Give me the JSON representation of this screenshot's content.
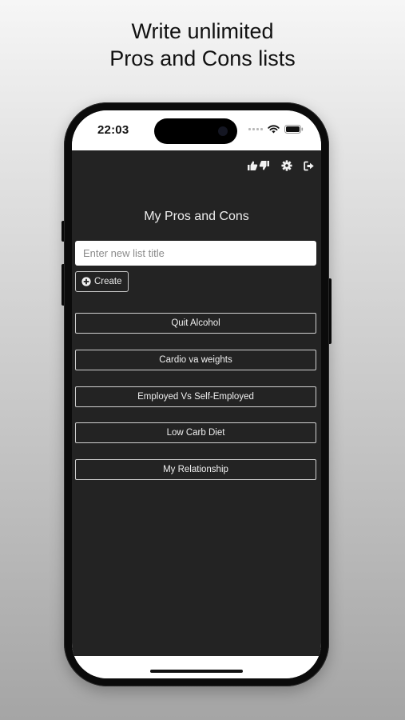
{
  "headline": {
    "line1": "Write unlimited",
    "line2": "Pros and Cons lists"
  },
  "status_bar": {
    "time": "22:03",
    "icons": [
      "cellular-signal-icon",
      "wifi-icon",
      "battery-icon"
    ]
  },
  "toolbar": {
    "icons": [
      "thumbs-up-down-icon",
      "gear-icon",
      "sign-out-icon"
    ]
  },
  "main": {
    "title": "My Pros and Cons",
    "new_list_placeholder": "Enter new list title",
    "new_list_value": "",
    "create_label": "Create",
    "lists": [
      {
        "label": "Quit Alcohol"
      },
      {
        "label": "Cardio va weights"
      },
      {
        "label": "Employed Vs Self-Employed"
      },
      {
        "label": "Low Carb Diet"
      },
      {
        "label": "My Relationship"
      }
    ]
  },
  "colors": {
    "app_background": "#232323",
    "text": "#efefef",
    "border": "#cfcfcf"
  }
}
